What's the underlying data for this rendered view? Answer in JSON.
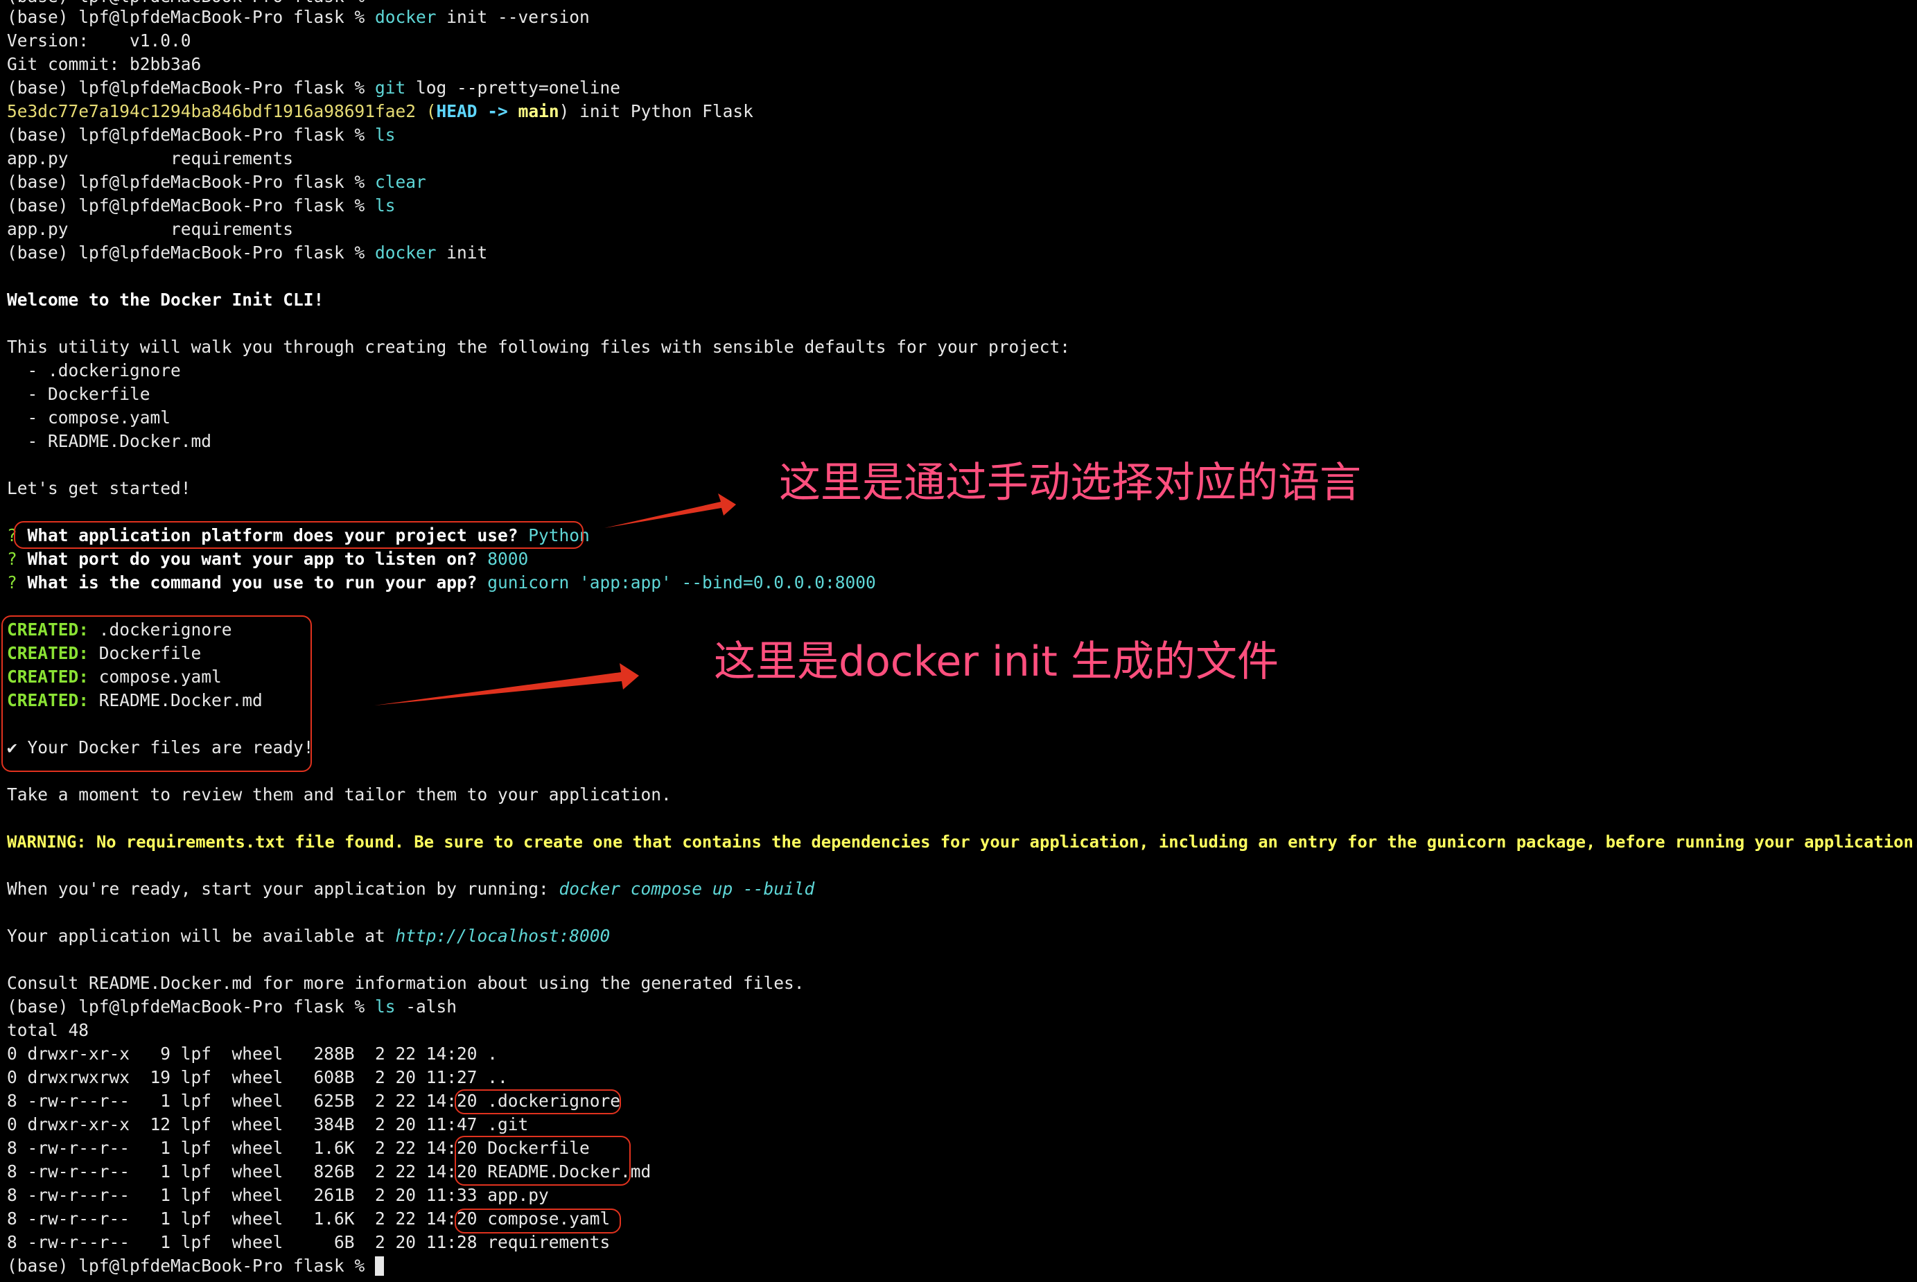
{
  "prompt": "(base) lpf@lpfdeMacBook-Pro flask %",
  "cmd_docker": "docker",
  "cmd_git": "git",
  "cmd_ls": "ls",
  "cmd_clear": "clear",
  "top_cut": "(base) lpf@lpfdeMacBook-Pro flask %",
  "l1_args": " init --version",
  "l2": "Version:    v1.0.0",
  "l3": "Git commit: b2bb3a6",
  "l4_args": " log --pretty=oneline",
  "l5_hash": "5e3dc77e7a194c1294ba846bdf1916a98691fae2",
  "l5_open": " (",
  "l5_head": "HEAD",
  "l5_arrow": " -> ",
  "l5_main": "main",
  "l5_rest": ") init Python Flask",
  "ls_out": "app.py          requirements",
  "l11_args": " init",
  "welcome": "Welcome to the Docker Init CLI!",
  "utility": "This utility will walk you through creating the following files with sensible defaults for your project:",
  "files": [
    "  - .dockerignore",
    "  - Dockerfile",
    "  - compose.yaml",
    "  - README.Docker.md"
  ],
  "started": "Let's get started!",
  "q_mark": "?",
  "q1": " What application platform does your project use?",
  "a1": " Python",
  "q2": " What port do you want your app to listen on?",
  "a2": " 8000",
  "q3": " What is the command you use to run your app?",
  "a3": " gunicorn 'app:app' --bind=0.0.0.0:8000",
  "created_label": "CREATED:",
  "created": [
    " .dockerignore",
    " Dockerfile",
    " compose.yaml",
    " README.Docker.md"
  ],
  "ready": "✔ Your Docker files are ready!",
  "review": "Take a moment to review them and tailor them to your application.",
  "warning": "WARNING: No requirements.txt file found. Be sure to create one that contains the dependencies for your application, including an entry for the gunicorn package, before running your application.",
  "run_pre": "When you're ready, start your application by running: ",
  "run_cmd": "docker compose up --build",
  "avail_pre": "Your application will be available at ",
  "avail_url": "http://localhost:8000",
  "consult": "Consult README.Docker.md for more information about using the generated files.",
  "lsalsh_args": " -alsh",
  "total": "total 48",
  "listing": [
    "0 drwxr-xr-x   9 lpf  wheel   288B  2 22 14:20 .",
    "0 drwxrwxrwx  19 lpf  wheel   608B  2 20 11:27 ..",
    "8 -rw-r--r--   1 lpf  wheel   625B  2 22 14:20 .dockerignore",
    "0 drwxr-xr-x  12 lpf  wheel   384B  2 20 11:47 .git",
    "8 -rw-r--r--   1 lpf  wheel   1.6K  2 22 14:20 Dockerfile",
    "8 -rw-r--r--   1 lpf  wheel   826B  2 22 14:20 README.Docker.md",
    "8 -rw-r--r--   1 lpf  wheel   261B  2 20 11:33 app.py",
    "8 -rw-r--r--   1 lpf  wheel   1.6K  2 22 14:20 compose.yaml",
    "8 -rw-r--r--   1 lpf  wheel     6B  2 20 11:28 requirements"
  ],
  "annotation_1": "这里是通过手动选择对应的语言",
  "annotation_2": "这里是docker init 生成的文件",
  "colors": {
    "background": "#000000",
    "command": "#5fd7d7",
    "created": "#8ae234",
    "warning": "#ffff5f",
    "annotation": "#ff4f7e",
    "highlight_box": "#e0321e"
  }
}
